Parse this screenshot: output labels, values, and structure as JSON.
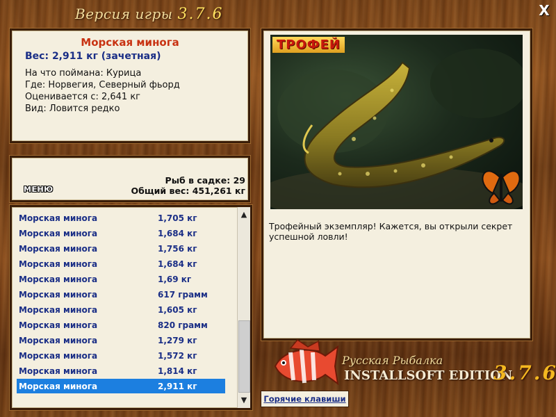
{
  "window": {
    "title_prefix": "Версия игры",
    "title_version": "3.7.6",
    "close_label": "X"
  },
  "catch_info": {
    "name": "Морская минога",
    "weight": "Вес: 2,911 кг (зачетная)",
    "lines": [
      "На что поймана: Курица",
      "Где: Норвегия, Северный фьорд",
      "Оценивается с: 2,641 кг",
      "Вид: Ловится редко"
    ]
  },
  "stats": {
    "fish_count": "Рыб в садке: 29",
    "total_weight": "Общий вес: 451,261 кг",
    "menu_label": "МЕНЮ"
  },
  "catch_list": [
    {
      "name": "Морская минога",
      "weight": "1,705 кг"
    },
    {
      "name": "Морская минога",
      "weight": "1,684 кг"
    },
    {
      "name": "Морская минога",
      "weight": "1,756 кг"
    },
    {
      "name": "Морская минога",
      "weight": "1,684 кг"
    },
    {
      "name": "Морская минога",
      "weight": "1,69 кг"
    },
    {
      "name": "Морская минога",
      "weight": "617 грамм"
    },
    {
      "name": "Морская минога",
      "weight": "1,605 кг"
    },
    {
      "name": "Морская минога",
      "weight": "820 грамм"
    },
    {
      "name": "Морская минога",
      "weight": "1,279 кг"
    },
    {
      "name": "Морская минога",
      "weight": "1,572 кг"
    },
    {
      "name": "Морская минога",
      "weight": "1,814 кг"
    },
    {
      "name": "Морская минога",
      "weight": "2,911 кг"
    }
  ],
  "selected_index": 11,
  "scrollbar": {
    "up_icon": "chevron-up-icon",
    "down_icon": "chevron-down-icon"
  },
  "detail": {
    "badge": "ТРОФЕЙ",
    "message": "Трофейный экземпляр! Кажется, вы открыли секрет успешной ловли!"
  },
  "hotkeys_label": "Горячие клавиши",
  "branding": {
    "line1": "Русская Рыбалка",
    "line2": "INSTALLSOFT EDITION",
    "version": "3.7.6"
  },
  "colors": {
    "wood": "#7a4418",
    "panel": "#f4efdf",
    "accent_red": "#c83212",
    "text_blue": "#1a2e86",
    "selection": "#1c7fe0"
  }
}
